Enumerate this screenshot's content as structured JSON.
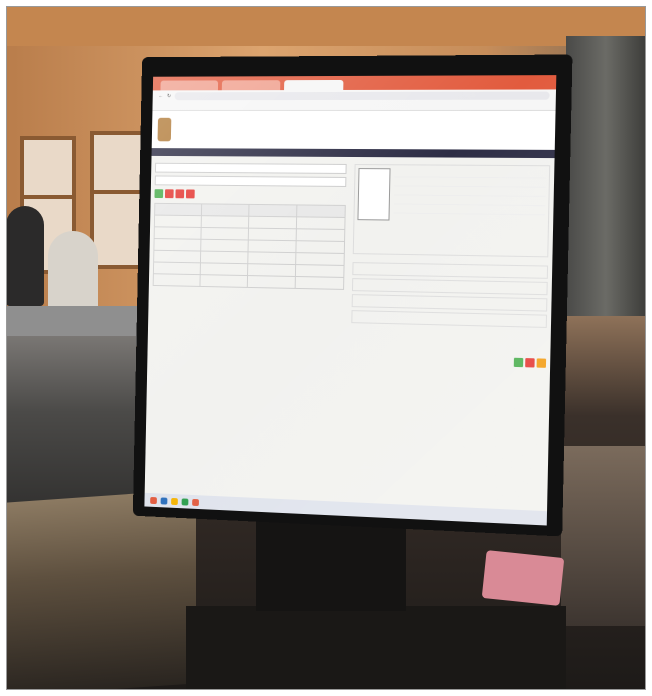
{
  "browser": {
    "tabs": [
      "",
      "",
      "",
      ""
    ],
    "address": ""
  },
  "site": {
    "title": "",
    "header_right": "",
    "nav_left": "",
    "nav_right": ""
  },
  "left_panel": {
    "section_title": "",
    "table_title": "",
    "info_lines": [
      "",
      "",
      ""
    ],
    "table_headers": [
      "",
      "",
      "",
      ""
    ],
    "rows": [
      [
        "",
        "",
        "",
        ""
      ],
      [
        "",
        "",
        "",
        ""
      ],
      [
        "",
        "",
        "",
        ""
      ],
      [
        "",
        "",
        "",
        ""
      ],
      [
        "",
        "",
        "",
        ""
      ],
      [
        "",
        "",
        "",
        ""
      ]
    ]
  },
  "right_panel": {
    "section_title": "",
    "welcome": "",
    "subtitle": ""
  },
  "monitor": {
    "brand": ""
  }
}
